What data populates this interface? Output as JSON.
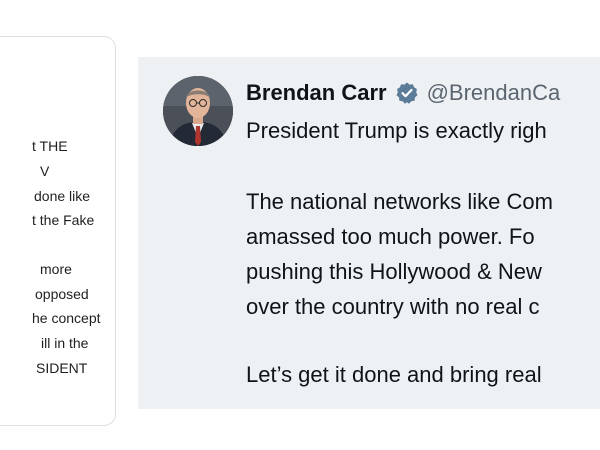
{
  "left_card": {
    "lines": [
      "t THE",
      "V",
      "done like",
      "t the Fake",
      "more",
      "opposed",
      "he concept",
      "ill in the",
      "SIDENT"
    ]
  },
  "tweet": {
    "author_name": "Brendan Carr",
    "handle": "@BrendanCa",
    "verified_icon": "verified-badge-icon",
    "accent_color": "#1d9bf0",
    "lines": [
      "President Trump is exactly righ",
      "The national networks like Com",
      "amassed too much power.  Fo",
      "pushing this Hollywood & New",
      "over the country with no real c",
      "Let’s get it done and bring real"
    ]
  }
}
